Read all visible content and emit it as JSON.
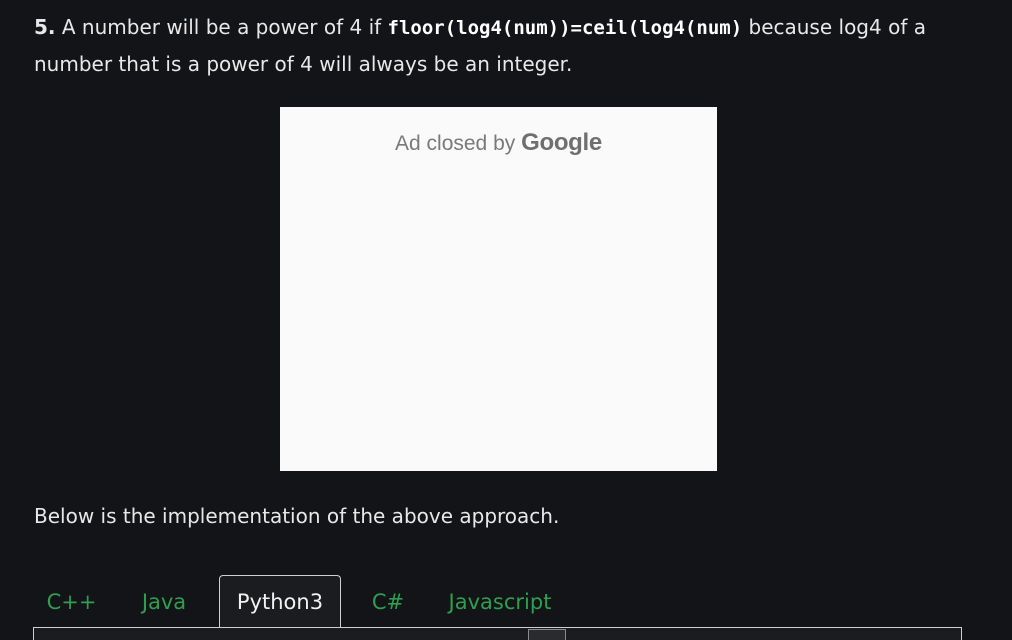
{
  "step": {
    "number": "5.",
    "text_1": " A number will be a power of 4 if ",
    "code": "floor(log4(num))=ceil(log4(num)",
    "text_2": " because log4 of a number that is a power of 4 will always be an integer."
  },
  "ad": {
    "prefix": "Ad closed by ",
    "brand": "Google"
  },
  "implementation_text": "Below is the implementation of the above approach.",
  "tabs": [
    {
      "label": "C++"
    },
    {
      "label": "Java"
    },
    {
      "label": "Python3",
      "active": true
    },
    {
      "label": "C#"
    },
    {
      "label": "Javascript"
    }
  ],
  "colors": {
    "background": "#131417",
    "tab_text": "#2f9e4f",
    "ad_background": "#fafafa"
  }
}
